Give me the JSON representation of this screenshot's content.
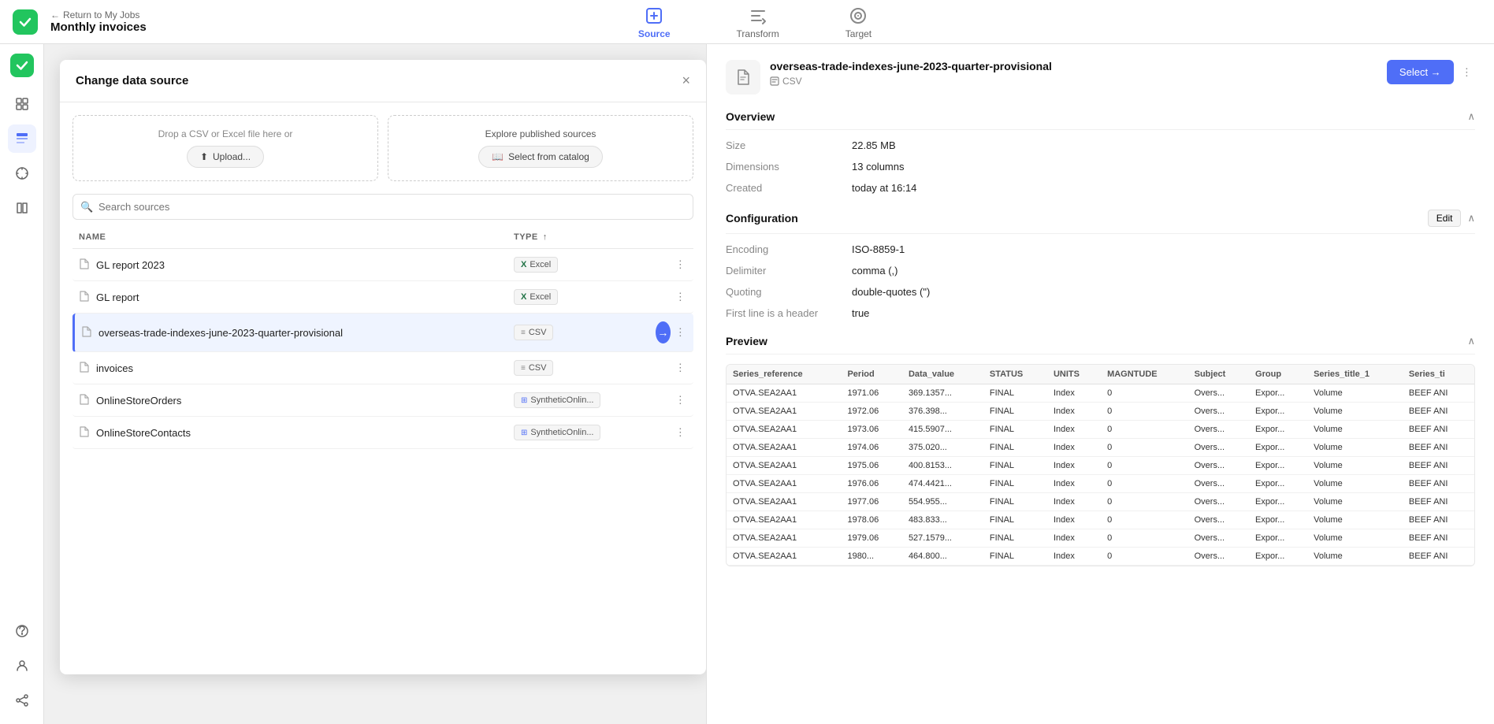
{
  "app": {
    "logo": "×",
    "back_label": "Return to My Jobs",
    "job_title": "Monthly invoices"
  },
  "nav_steps": [
    {
      "id": "source",
      "label": "Source",
      "active": true
    },
    {
      "id": "transform",
      "label": "Transform",
      "active": false
    },
    {
      "id": "target",
      "label": "Target",
      "active": false
    }
  ],
  "modal": {
    "title": "Change data source",
    "close_label": "×",
    "upload_section": {
      "hint": "Drop a CSV or Excel file here or",
      "upload_btn": "Upload..."
    },
    "catalog_section": {
      "label": "Explore published sources",
      "btn_label": "Select from catalog"
    },
    "search": {
      "placeholder": "Search sources"
    },
    "table_headers": {
      "name": "NAME",
      "type": "TYPE"
    },
    "rows": [
      {
        "id": 1,
        "name": "GL report 2023",
        "type": "Excel",
        "type_icon": "excel",
        "selected": false
      },
      {
        "id": 2,
        "name": "GL report",
        "type": "Excel",
        "type_icon": "excel",
        "selected": false
      },
      {
        "id": 3,
        "name": "overseas-trade-indexes-june-2023-quarter-provisional",
        "type": "CSV",
        "type_icon": "csv",
        "selected": true
      },
      {
        "id": 4,
        "name": "invoices",
        "type": "CSV",
        "type_icon": "csv",
        "selected": false
      },
      {
        "id": 5,
        "name": "OnlineStoreOrders",
        "type": "SyntheticOnlin...",
        "type_icon": "synth",
        "selected": false
      },
      {
        "id": 6,
        "name": "OnlineStoreContacts",
        "type": "SyntheticOnlin...",
        "type_icon": "synth",
        "selected": false
      }
    ]
  },
  "detail": {
    "title": "overseas-trade-indexes-june-2023-quarter-provisional",
    "subtitle": "CSV",
    "select_btn": "Select →",
    "overview": {
      "section_title": "Overview",
      "size_label": "Size",
      "size_value": "22.85 MB",
      "dimensions_label": "Dimensions",
      "dimensions_value": "13 columns",
      "created_label": "Created",
      "created_value": "today at 16:14"
    },
    "configuration": {
      "section_title": "Configuration",
      "edit_btn": "Edit",
      "encoding_label": "Encoding",
      "encoding_value": "ISO-8859-1",
      "delimiter_label": "Delimiter",
      "delimiter_value": "comma (,)",
      "quoting_label": "Quoting",
      "quoting_value": "double-quotes (\")",
      "first_line_label": "First line is a header",
      "first_line_value": "true"
    },
    "preview": {
      "section_title": "Preview",
      "columns": [
        "Series_reference",
        "Period",
        "Data_value",
        "STATUS",
        "UNITS",
        "MAGNTUDE",
        "Subject",
        "Group",
        "Series_title_1",
        "Series_ti"
      ],
      "rows": [
        [
          "OTVA.SEA2AA1",
          "1971.06",
          "369.1357...",
          "FINAL",
          "Index",
          "0",
          "Overs...",
          "Expor...",
          "Volume",
          "BEEF ANI"
        ],
        [
          "OTVA.SEA2AA1",
          "1972.06",
          "376.398...",
          "FINAL",
          "Index",
          "0",
          "Overs...",
          "Expor...",
          "Volume",
          "BEEF ANI"
        ],
        [
          "OTVA.SEA2AA1",
          "1973.06",
          "415.5907...",
          "FINAL",
          "Index",
          "0",
          "Overs...",
          "Expor...",
          "Volume",
          "BEEF ANI"
        ],
        [
          "OTVA.SEA2AA1",
          "1974.06",
          "375.020...",
          "FINAL",
          "Index",
          "0",
          "Overs...",
          "Expor...",
          "Volume",
          "BEEF ANI"
        ],
        [
          "OTVA.SEA2AA1",
          "1975.06",
          "400.8153...",
          "FINAL",
          "Index",
          "0",
          "Overs...",
          "Expor...",
          "Volume",
          "BEEF ANI"
        ],
        [
          "OTVA.SEA2AA1",
          "1976.06",
          "474.4421...",
          "FINAL",
          "Index",
          "0",
          "Overs...",
          "Expor...",
          "Volume",
          "BEEF ANI"
        ],
        [
          "OTVA.SEA2AA1",
          "1977.06",
          "554.955...",
          "FINAL",
          "Index",
          "0",
          "Overs...",
          "Expor...",
          "Volume",
          "BEEF ANI"
        ],
        [
          "OTVA.SEA2AA1",
          "1978.06",
          "483.833...",
          "FINAL",
          "Index",
          "0",
          "Overs...",
          "Expor...",
          "Volume",
          "BEEF ANI"
        ],
        [
          "OTVA.SEA2AA1",
          "1979.06",
          "527.1579...",
          "FINAL",
          "Index",
          "0",
          "Overs...",
          "Expor...",
          "Volume",
          "BEEF ANI"
        ],
        [
          "OTVA.SEA2AA1",
          "1980...",
          "464.800...",
          "FINAL",
          "Index",
          "0",
          "Overs...",
          "Expor...",
          "Volume",
          "BEEF ANI"
        ]
      ]
    }
  },
  "sidebar": {
    "items": [
      {
        "id": "dashboard",
        "icon": "grid"
      },
      {
        "id": "jobs",
        "icon": "list",
        "active": true
      },
      {
        "id": "explore",
        "icon": "compass"
      },
      {
        "id": "catalog",
        "icon": "book"
      },
      {
        "id": "help",
        "icon": "help"
      },
      {
        "id": "user",
        "icon": "user"
      },
      {
        "id": "share",
        "icon": "share"
      }
    ]
  }
}
